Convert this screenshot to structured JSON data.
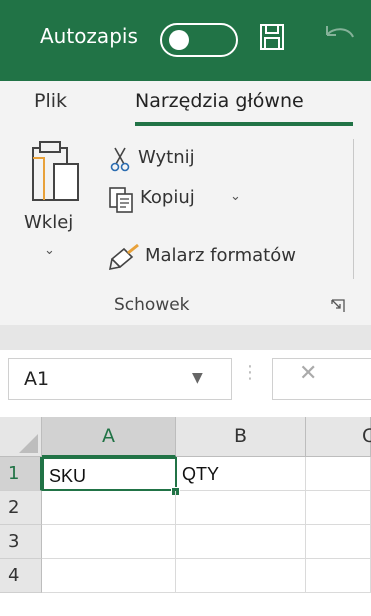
{
  "titlebar": {
    "autosave_label": "Autozapis",
    "autosave_state": "off",
    "accent_color": "#217346"
  },
  "ribbon": {
    "tabs": [
      {
        "label": "Plik",
        "active": false
      },
      {
        "label": "Narzędzia główne",
        "active": true
      }
    ],
    "clipboard": {
      "paste_label": "Wklej",
      "cut_label": "Wytnij",
      "copy_label": "Kopiuj",
      "format_painter_label": "Malarz formatów",
      "group_label": "Schowek"
    }
  },
  "formula_bar": {
    "namebox_value": "A1"
  },
  "grid": {
    "columns": [
      "A",
      "B",
      "C"
    ],
    "rows": [
      "1",
      "2",
      "3",
      "4"
    ],
    "cells": {
      "A1": "SKU",
      "B1": "QTY"
    },
    "active_cell": "A1"
  },
  "icons": [
    "paste-icon",
    "scissors-icon",
    "copy-icon",
    "format-painter-icon",
    "save-icon",
    "undo-icon",
    "dialog-launcher-icon",
    "chevron-down-icon",
    "cancel-icon"
  ]
}
